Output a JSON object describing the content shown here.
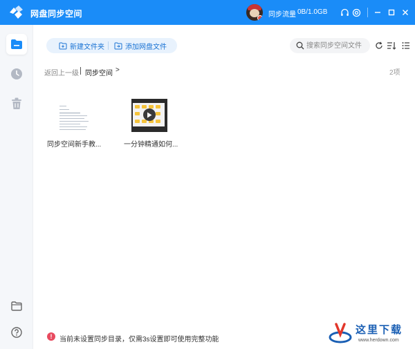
{
  "app": {
    "title": "网盘同步空间"
  },
  "header": {
    "traffic_label": "同步流量",
    "traffic_value": "0B/1.0GB",
    "icons": [
      "headset-icon",
      "settings-icon",
      "minimize-icon",
      "maximize-icon",
      "close-icon"
    ]
  },
  "sidebar": {
    "items": [
      {
        "icon": "sync-folder-icon",
        "active": true
      },
      {
        "icon": "history-icon",
        "active": false
      },
      {
        "icon": "trash-icon",
        "active": false
      }
    ],
    "bottom": [
      "folder-icon",
      "help-icon"
    ]
  },
  "toolbar": {
    "new_folder_label": "新建文件夹",
    "add_file_label": "添加网盘文件",
    "search_placeholder": "搜索同步空间文件"
  },
  "breadcrumb": {
    "back_label": "返回上一级",
    "current": "同步空间",
    "arrow": ">",
    "count": "2项"
  },
  "files": [
    {
      "name": "同步空间新手教...",
      "type": "document"
    },
    {
      "name": "一分钟精通如何...",
      "type": "video"
    }
  ],
  "notice": {
    "icon_text": "!",
    "text": "当前未设置同步目录，仅需3s设置即可使用完整功能"
  },
  "watermark": {
    "title": "这里下载",
    "url": "www.herdown.com"
  },
  "colors": {
    "accent": "#1a8cf8",
    "notice": "#e84a5f",
    "pill_bg": "#e8f2fd"
  }
}
